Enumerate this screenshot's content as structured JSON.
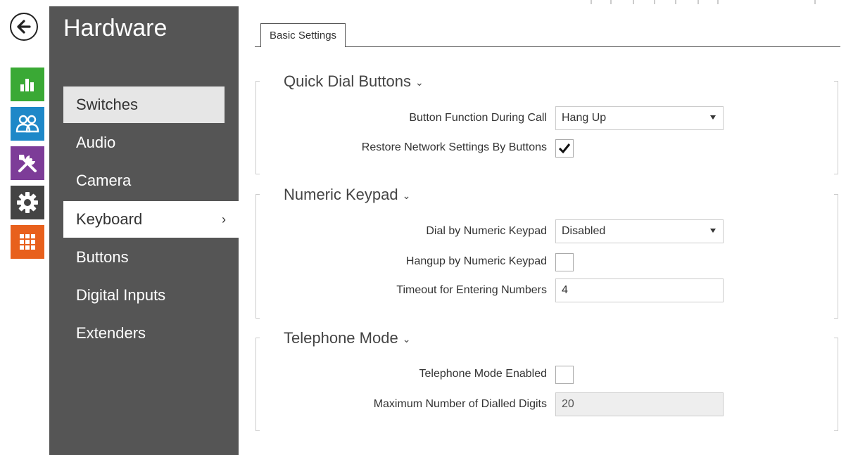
{
  "rail": {
    "icons": [
      {
        "name": "status-icon",
        "color": "#3aa935"
      },
      {
        "name": "users-icon",
        "color": "#1e88c8"
      },
      {
        "name": "hardware-tools-icon",
        "color": "#7d3c98"
      },
      {
        "name": "settings-gear-icon",
        "color": "#444444"
      },
      {
        "name": "services-grid-icon",
        "color": "#e8601c"
      }
    ]
  },
  "menu": {
    "title": "Hardware",
    "items": [
      {
        "label": "Switches",
        "state": "hover"
      },
      {
        "label": "Audio",
        "state": "normal"
      },
      {
        "label": "Camera",
        "state": "normal"
      },
      {
        "label": "Keyboard",
        "state": "active"
      },
      {
        "label": "Buttons",
        "state": "normal"
      },
      {
        "label": "Digital Inputs",
        "state": "normal"
      },
      {
        "label": "Extenders",
        "state": "normal"
      }
    ],
    "active_chevron": "›"
  },
  "tabs": [
    {
      "label": "Basic Settings",
      "selected": true
    }
  ],
  "sections": {
    "quick_dial": {
      "title": "Quick Dial Buttons",
      "button_function_label": "Button Function During Call",
      "button_function_value": "Hang Up",
      "restore_network_label": "Restore Network Settings By Buttons",
      "restore_network_checked": true
    },
    "numeric_keypad": {
      "title": "Numeric Keypad",
      "dial_label": "Dial by Numeric Keypad",
      "dial_value": "Disabled",
      "hangup_label": "Hangup by Numeric Keypad",
      "hangup_checked": false,
      "timeout_label": "Timeout for Entering Numbers",
      "timeout_value": "4"
    },
    "telephone_mode": {
      "title": "Telephone Mode",
      "enabled_label": "Telephone Mode Enabled",
      "enabled_checked": false,
      "max_digits_label": "Maximum Number of Dialled Digits",
      "max_digits_value": "20"
    }
  },
  "colors": {
    "menu_bg": "#555555",
    "menu_hover": "#e6e6e6",
    "accent_text": "#333333"
  }
}
